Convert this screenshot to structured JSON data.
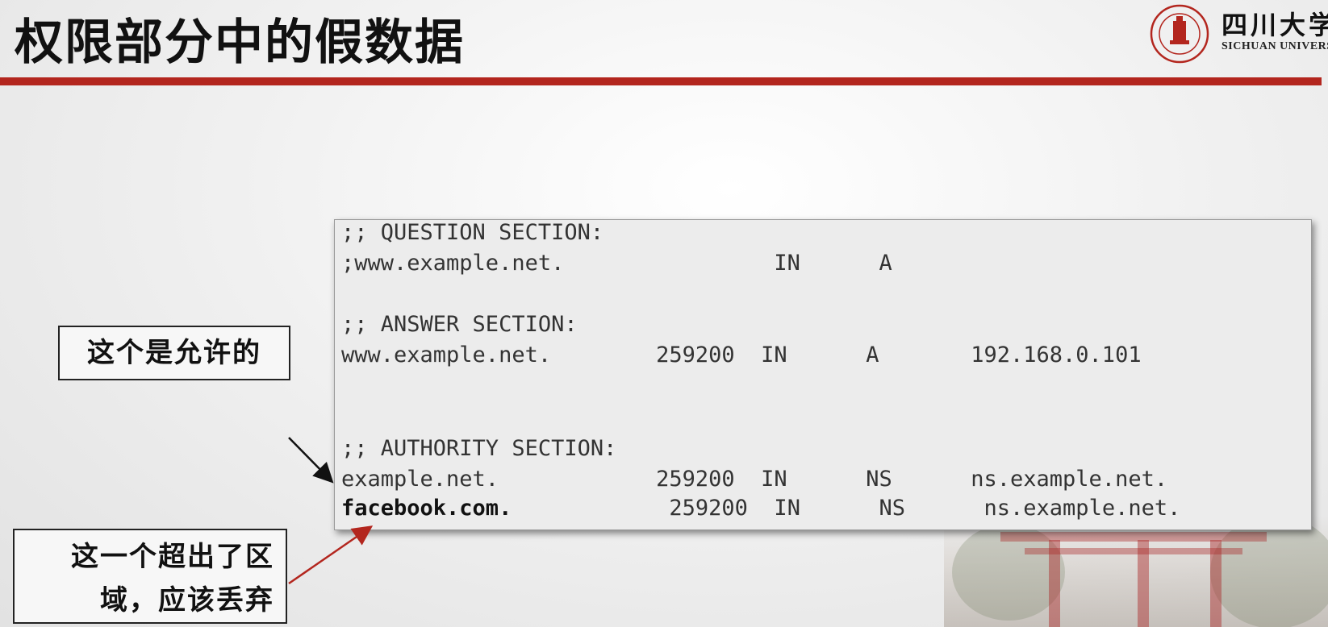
{
  "slide": {
    "title": "权限部分中的假数据"
  },
  "logo": {
    "name_cn": "四川大学",
    "name_en": "SICHUAN UNIVERSITY"
  },
  "dns_output": {
    "question_header": ";; QUESTION SECTION:",
    "question_row": ";www.example.net.                IN      A",
    "answer_header": ";; ANSWER SECTION:",
    "answer_row": "www.example.net.        259200  IN      A       192.168.0.101",
    "authority_header": ";; AUTHORITY SECTION:",
    "authority_row_1": "example.net.            259200  IN      NS      ns.example.net.",
    "authority_row_2_name": "facebook.com.",
    "authority_row_2_rest": "            259200  IN      NS      ns.example.net."
  },
  "annotations": {
    "allowed_label": "这个是允许的",
    "discard_label_line1": "这一个超出了区",
    "discard_label_line2": "域，应该丢弃"
  },
  "colors": {
    "accent_red": "#b3261e",
    "arrow_black": "#111111",
    "arrow_red": "#b3261e"
  }
}
